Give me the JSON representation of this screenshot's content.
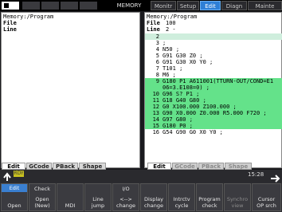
{
  "header": {
    "mode": "MEMORY",
    "tabs": [
      {
        "label": "Monitr",
        "active": false
      },
      {
        "label": "Setup",
        "active": false
      },
      {
        "label": "Edit",
        "active": true
      },
      {
        "label": "Diagn",
        "active": false
      },
      {
        "label": "Mainte",
        "active": false
      }
    ]
  },
  "left_pane": {
    "path": "Memory:/Program",
    "file_label": "File",
    "file_value": "",
    "line_label": "Line",
    "line_value": ""
  },
  "right_pane": {
    "path": "Memory:/Program",
    "file_label": "File",
    "file_value": "100",
    "line_label": "Line",
    "line_value": "2 -",
    "lines": [
      {
        "num": "2",
        "text": "",
        "highlight": "cursor"
      },
      {
        "num": "3",
        "text": ";",
        "highlight": "none"
      },
      {
        "num": "4",
        "text": "N50 ;",
        "highlight": "none"
      },
      {
        "num": "5",
        "text": "G91 G30 Z0 ;",
        "highlight": "none"
      },
      {
        "num": "6",
        "text": "G91 G30 X0 Y0 ;",
        "highlight": "none"
      },
      {
        "num": "7",
        "text": "T101 ;",
        "highlight": "none"
      },
      {
        "num": "8",
        "text": "M6 ;",
        "highlight": "none"
      },
      {
        "num": "9",
        "text": "G180 P1 A611001(TTURN-OUT/COND=E1",
        "highlight": "green"
      },
      {
        "num": "",
        "text": "06=3.E108=0) ;",
        "highlight": "green"
      },
      {
        "num": "10",
        "text": "G96 S? P1 ;",
        "highlight": "green"
      },
      {
        "num": "11",
        "text": "G18 G40 G80 ;",
        "highlight": "green"
      },
      {
        "num": "12",
        "text": "G0 X100.000 Z100.000 ;",
        "highlight": "green"
      },
      {
        "num": "13",
        "text": "G90 X0.000 Z0.000 R5.000 F720 ;",
        "highlight": "green"
      },
      {
        "num": "14",
        "text": "G97 G80 ;",
        "highlight": "green"
      },
      {
        "num": "15",
        "text": "G180 P0 ;",
        "highlight": "green"
      },
      {
        "num": "16",
        "text": "G54 G90 G0 X0 Y0 ;",
        "highlight": "none"
      }
    ]
  },
  "left_tabs": [
    {
      "label": "Edit",
      "state": "sel"
    },
    {
      "label": "GCode",
      "state": "normal"
    },
    {
      "label": "PBack",
      "state": "normal"
    },
    {
      "label": "Shape",
      "state": "normal"
    }
  ],
  "right_tabs": [
    {
      "label": "Edit",
      "state": "sel"
    },
    {
      "label": "GCode",
      "state": "dim"
    },
    {
      "label": "PBack",
      "state": "dim"
    },
    {
      "label": "Shape",
      "state": "dim"
    }
  ],
  "status": {
    "ready_label": "RDY",
    "clock": "15:28"
  },
  "softkeys": [
    {
      "top": "Edit",
      "bottom": "Open",
      "blue": true,
      "dim": false
    },
    {
      "top": "Check",
      "bottom": "Open\n(New)",
      "blue": false,
      "dim": false
    },
    {
      "top": "",
      "bottom": "MDI",
      "blue": false,
      "dim": false
    },
    {
      "top": "",
      "bottom": "Line\njump",
      "blue": false,
      "dim": false
    },
    {
      "top": "I/O",
      "bottom": "<-->\nchange",
      "blue": false,
      "dim": false
    },
    {
      "top": "",
      "bottom": "Display\nchange",
      "blue": false,
      "dim": false
    },
    {
      "top": "",
      "bottom": "Intrctv\ncycle",
      "blue": false,
      "dim": false
    },
    {
      "top": "",
      "bottom": "Program\ncheck",
      "blue": false,
      "dim": false
    },
    {
      "top": "",
      "bottom": "Synchro\nview",
      "blue": false,
      "dim": true
    },
    {
      "top": "",
      "bottom": "Cursor\nOP srch",
      "blue": false,
      "dim": false
    }
  ],
  "colors": {
    "accent": "#2e7fd6",
    "highlight_green": "#64e28a",
    "ready": "#c8c020"
  },
  "icons": {
    "logo": "nc-logo-icon",
    "back": "back-arrow-icon",
    "forward": "forward-arrow-icon"
  }
}
